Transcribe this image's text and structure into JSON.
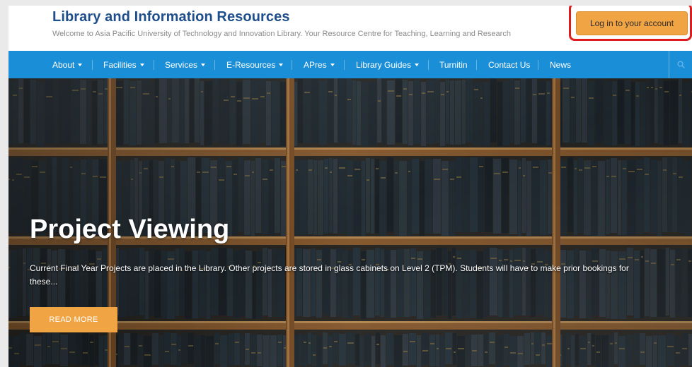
{
  "header": {
    "title": "Library and Information Resources",
    "tagline": "Welcome to Asia Pacific University of Technology and Innovation Library. Your Resource Centre for Teaching, Learning and Research",
    "login_label": "Log in to your account"
  },
  "nav": {
    "items": [
      {
        "label": "About",
        "dropdown": true
      },
      {
        "label": "Facilities",
        "dropdown": true
      },
      {
        "label": "Services",
        "dropdown": true
      },
      {
        "label": "E-Resources",
        "dropdown": true
      },
      {
        "label": "APres",
        "dropdown": true
      },
      {
        "label": "Library Guides",
        "dropdown": true
      },
      {
        "label": "Turnitin",
        "dropdown": false
      },
      {
        "label": "Contact Us",
        "dropdown": false
      },
      {
        "label": "News",
        "dropdown": false
      }
    ],
    "search_icon": "search-icon"
  },
  "hero": {
    "title": "Project Viewing",
    "text": "Current Final Year Projects are placed in the Library. Other projects are stored in glass cabinets on Level 2 (TPM). Students will have to make prior bookings for these...",
    "button_label": "READ MORE"
  },
  "colors": {
    "title_blue": "#1f4e8c",
    "nav_blue": "#1a8fd8",
    "accent_orange": "#f0a443",
    "highlight_red": "#e01b1b"
  }
}
